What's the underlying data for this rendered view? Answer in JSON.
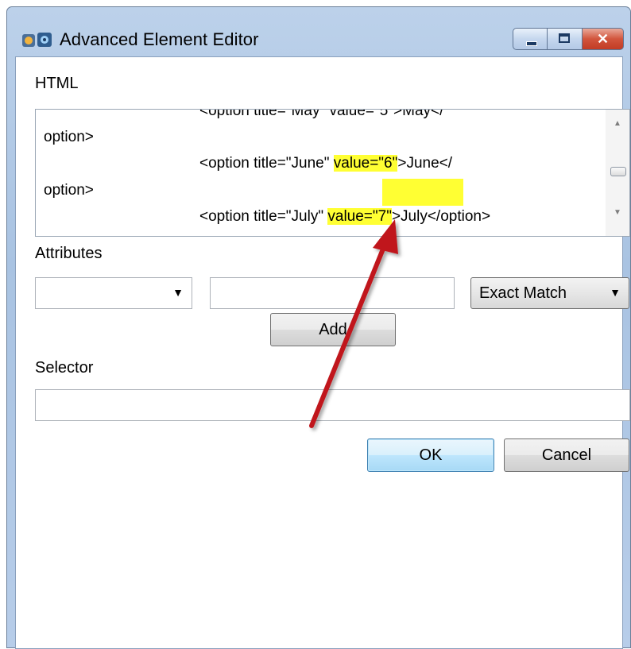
{
  "window": {
    "title": "Advanced Element Editor",
    "app_icon": "app-icon",
    "controls": {
      "minimize": "minimize-icon",
      "maximize": "maximize-icon",
      "close_glyph": "✕"
    }
  },
  "html_section": {
    "label": "HTML",
    "lines": [
      {
        "text": "<option title=\"May\" value=\"5\">May</"
      },
      {
        "text": "option>"
      },
      {
        "before": "<option title=\"June\" ",
        "highlight": "value=\"6\"",
        "after": ">June</"
      },
      {
        "text": "option>"
      },
      {
        "before": "<option title=\"July\" ",
        "highlight": "value=\"7\"",
        "after": ">July</option>"
      }
    ],
    "highlight_color": "#ffff33"
  },
  "attributes": {
    "label": "Attributes",
    "name_value": "",
    "value_text": "",
    "match_mode": "Exact Match",
    "add_label": "Add"
  },
  "selector": {
    "label": "Selector",
    "value": ""
  },
  "buttons": {
    "ok": "OK",
    "cancel": "Cancel"
  },
  "annotation": {
    "arrow_color": "#c0171d"
  }
}
